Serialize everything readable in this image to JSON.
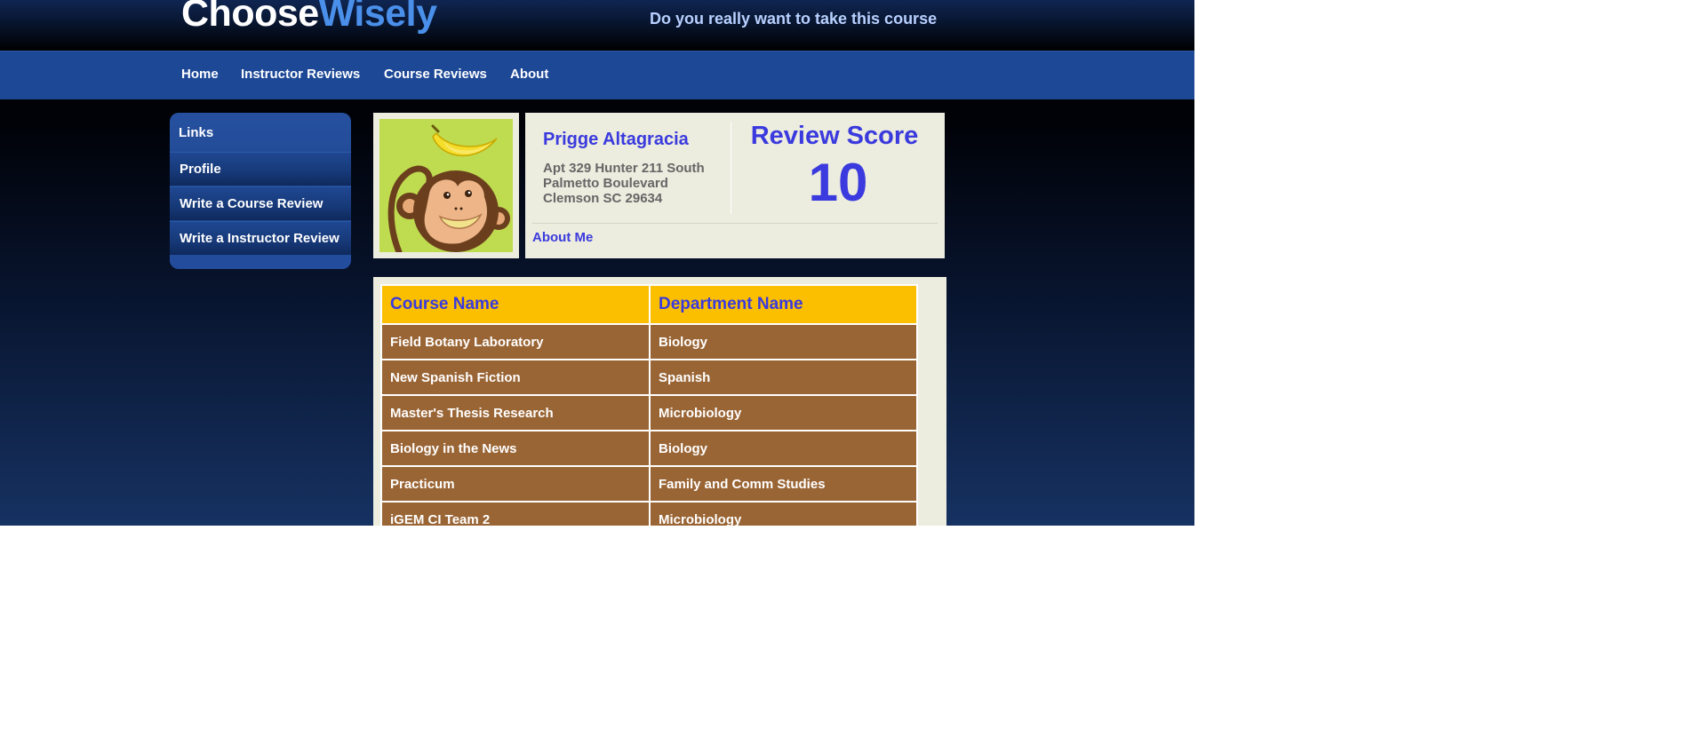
{
  "header": {
    "logo_part1": "Choose",
    "logo_part2": "Wisely",
    "tagline": "Do you really want to take this course"
  },
  "nav": {
    "items": [
      {
        "label": "Home"
      },
      {
        "label": "Instructor Reviews"
      },
      {
        "label": "Course Reviews"
      },
      {
        "label": "About"
      }
    ]
  },
  "sidebar": {
    "title": "Links",
    "items": [
      {
        "label": "Profile"
      },
      {
        "label": "Write a Course Review"
      },
      {
        "label": "Write a Instructor Review"
      }
    ]
  },
  "profile": {
    "photo_icon": "monkey-with-banana",
    "name": "Prigge Altagracia",
    "address_lines": [
      "Apt 329 Hunter 211 South",
      "Palmetto Boulevard",
      "Clemson SC 29634"
    ],
    "score_label": "Review Score",
    "score_value": "10",
    "about_label": "About Me"
  },
  "courses": {
    "headers": [
      "Course Name",
      "Department Name"
    ],
    "rows": [
      [
        "Field Botany Laboratory",
        "Biology"
      ],
      [
        "New Spanish Fiction",
        "Spanish"
      ],
      [
        "Master's Thesis Research",
        "Microbiology"
      ],
      [
        "Biology in the News",
        "Biology"
      ],
      [
        "Practicum",
        "Family and Comm Studies"
      ],
      [
        "iGEM CI Team 2",
        "Microbiology"
      ]
    ]
  },
  "colors": {
    "accent_blue": "#3a3ade",
    "nav_blue": "#1d4896",
    "table_header": "#fbbf00",
    "table_row": "#9a6535",
    "card_bg": "#ececdf"
  }
}
